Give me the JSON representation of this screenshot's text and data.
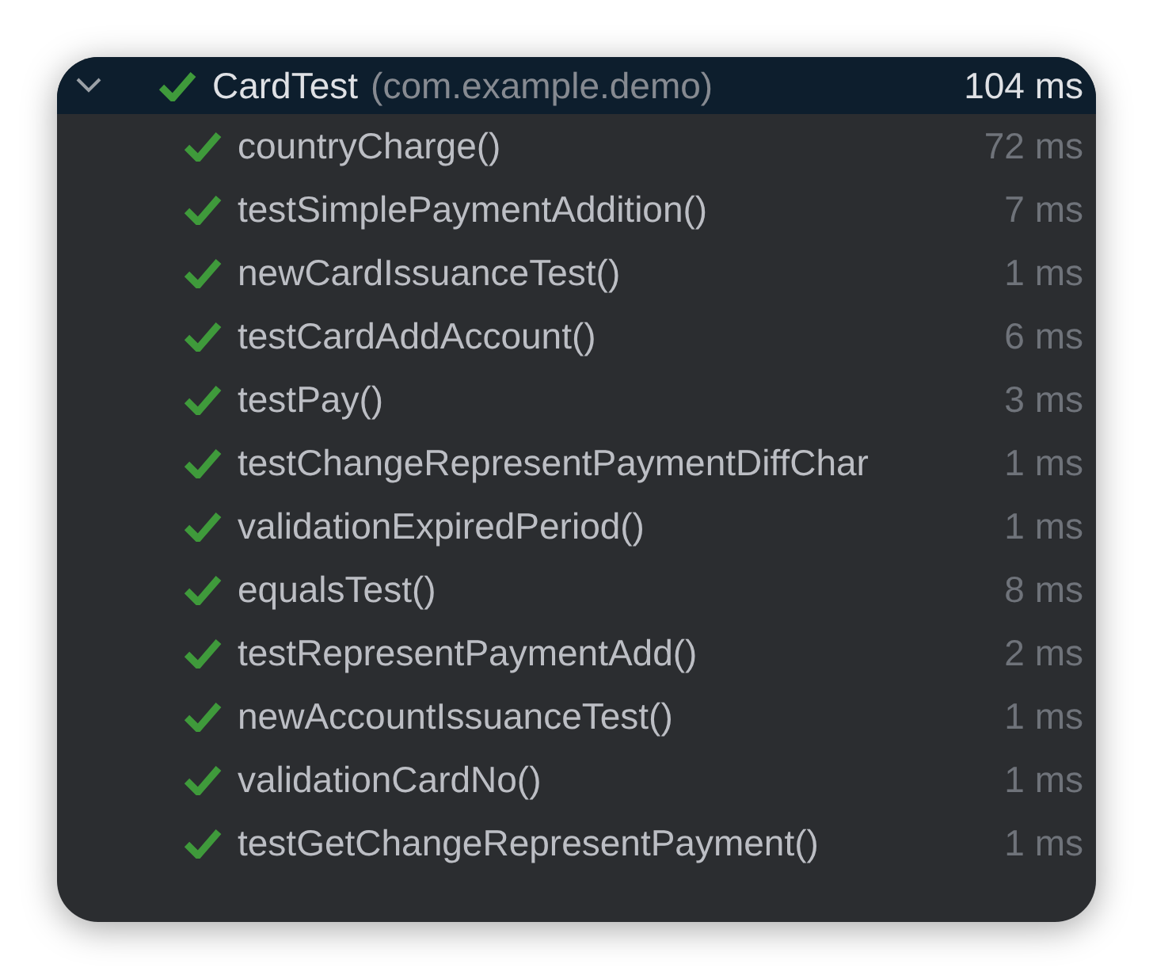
{
  "suite": {
    "name": "CardTest",
    "package": "(com.example.demo)",
    "time": "104 ms",
    "passed": true,
    "expanded": true,
    "selected": true
  },
  "tests": [
    {
      "name": "countryCharge()",
      "time": "72 ms",
      "passed": true,
      "selected": false
    },
    {
      "name": "testSimplePaymentAddition()",
      "time": "7 ms",
      "passed": true,
      "selected": false
    },
    {
      "name": "newCardIssuanceTest()",
      "time": "1 ms",
      "passed": true,
      "selected": false
    },
    {
      "name": "testCardAddAccount()",
      "time": "6 ms",
      "passed": true,
      "selected": false
    },
    {
      "name": "testPay()",
      "time": "3 ms",
      "passed": true,
      "selected": false
    },
    {
      "name": "testChangeRepresentPaymentDiffChar",
      "time": "1 ms",
      "passed": true,
      "selected": false
    },
    {
      "name": "validationExpiredPeriod()",
      "time": "1 ms",
      "passed": true,
      "selected": false
    },
    {
      "name": "equalsTest()",
      "time": "8 ms",
      "passed": true,
      "selected": false
    },
    {
      "name": "testRepresentPaymentAdd()",
      "time": "2 ms",
      "passed": true,
      "selected": false
    },
    {
      "name": "newAccountIssuanceTest()",
      "time": "1 ms",
      "passed": true,
      "selected": false
    },
    {
      "name": "validationCardNo()",
      "time": "1 ms",
      "passed": true,
      "selected": false
    },
    {
      "name": "testGetChangeRepresentPayment()",
      "time": "1 ms",
      "passed": true,
      "selected": false
    }
  ]
}
